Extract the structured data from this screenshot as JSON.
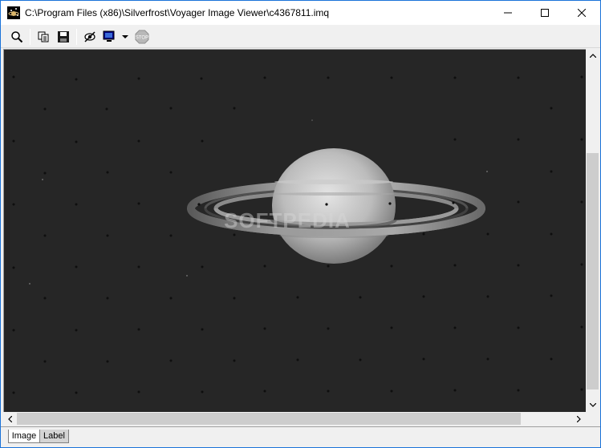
{
  "window": {
    "title": "C:\\Program Files (x86)\\Silverfrost\\Voyager Image Viewer\\c4367811.imq"
  },
  "toolbar": {
    "buttons": [
      {
        "name": "zoom",
        "icon": "magnifier-icon"
      },
      {
        "name": "copy",
        "icon": "copy-icon"
      },
      {
        "name": "save",
        "icon": "floppy-disk-icon"
      },
      {
        "name": "mask",
        "icon": "eye-slash-icon"
      },
      {
        "name": "display",
        "icon": "monitor-icon"
      },
      {
        "name": "stop",
        "icon": "stop-icon",
        "label": "STOP"
      }
    ]
  },
  "image": {
    "watermark": "SOFTPEDIA",
    "subject": "saturn"
  },
  "tabs": [
    {
      "label": "Image",
      "active": true
    },
    {
      "label": "Label",
      "active": false
    }
  ],
  "colors": {
    "titlebar_border": "#1a73d9",
    "image_background": "#262626",
    "tab_active": "#ffffff",
    "tab_inactive": "#d4d4d4"
  }
}
